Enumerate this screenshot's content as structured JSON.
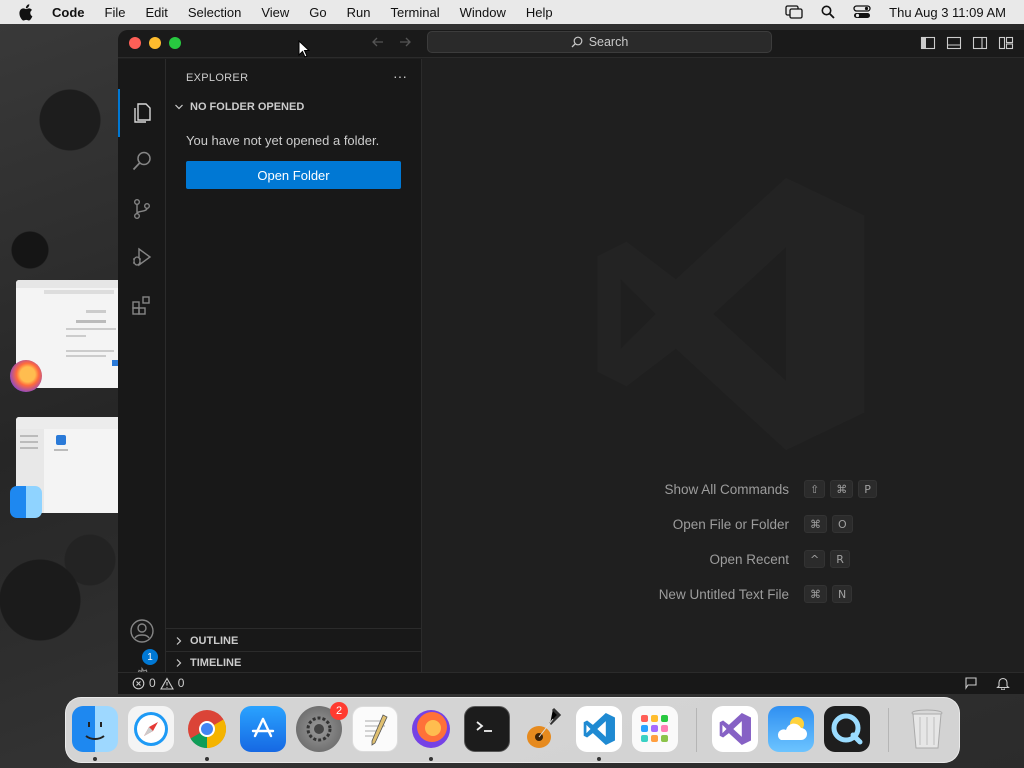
{
  "menubar": {
    "app_name": "Code",
    "items": [
      "File",
      "Edit",
      "Selection",
      "View",
      "Go",
      "Run",
      "Terminal",
      "Window",
      "Help"
    ],
    "clock": "Thu Aug 3  11:09 AM"
  },
  "titlebar": {
    "search_label": "Search"
  },
  "sidebar": {
    "title": "EXPLORER",
    "section_main": "NO FOLDER OPENED",
    "message": "You have not yet opened a folder.",
    "open_folder_label": "Open Folder",
    "section_outline": "OUTLINE",
    "section_timeline": "TIMELINE"
  },
  "activitybar": {
    "items": [
      "explorer-icon",
      "search-icon",
      "source-control-icon",
      "run-debug-icon",
      "extensions-icon"
    ],
    "accounts": "account-icon",
    "manage": "gear-icon",
    "manage_badge": "1"
  },
  "editor": {
    "commands": [
      {
        "label": "Show All Commands",
        "keys": [
          "⇧",
          "⌘",
          "P"
        ]
      },
      {
        "label": "Open File or Folder",
        "keys": [
          "⌘",
          "O"
        ]
      },
      {
        "label": "Open Recent",
        "keys": [
          "^",
          "R"
        ]
      },
      {
        "label": "New Untitled Text File",
        "keys": [
          "⌘",
          "N"
        ]
      }
    ]
  },
  "statusbar": {
    "errors": "0",
    "warnings": "0"
  },
  "dock": {
    "apps": [
      "Finder",
      "Safari",
      "Chrome",
      "App Store",
      "System Settings",
      "TextEdit",
      "Firefox",
      "Terminal",
      "GarageBand",
      "Visual Studio Code",
      "Launchpad",
      "Visual Studio",
      "Weather",
      "QuickTime Player",
      "Trash"
    ],
    "settings_badge": "2"
  },
  "colors": {
    "accent": "#0078d4",
    "menubar_bg": "#e9e9e9",
    "editor_bg": "#1f1f1f",
    "sidebar_bg": "#181818"
  }
}
